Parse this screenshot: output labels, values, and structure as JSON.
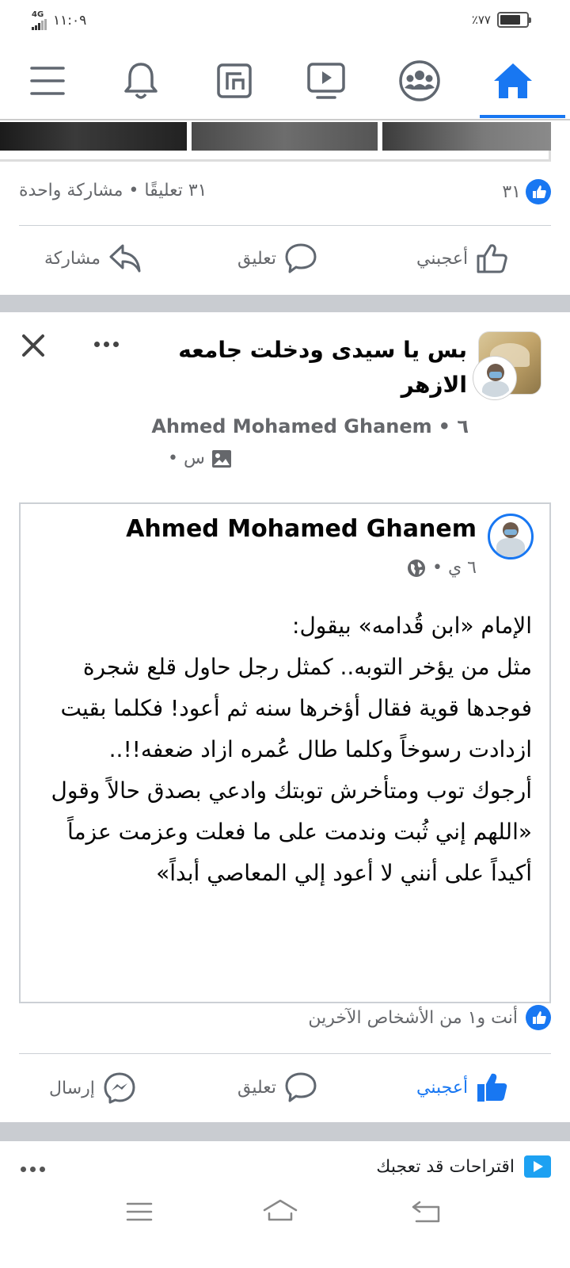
{
  "status_bar": {
    "network": "4G",
    "time": "١١:٠٩",
    "battery": "٪٧٧",
    "battery_level": 0.77
  },
  "top_nav": {
    "items": [
      {
        "icon": "home-icon",
        "active": true
      },
      {
        "icon": "groups-icon",
        "active": false
      },
      {
        "icon": "watch-icon",
        "active": false
      },
      {
        "icon": "pages-icon",
        "active": false
      },
      {
        "icon": "bell-icon",
        "active": false
      },
      {
        "icon": "menu-icon",
        "active": false
      }
    ],
    "accent": "#1877f2"
  },
  "prev_post": {
    "reactions_count": "٣١",
    "comments_shares": "٣١ تعليقًا • مشاركة واحدة",
    "like_label": "أعجبني",
    "comment_label": "تعليق",
    "share_label": "مشاركة"
  },
  "post": {
    "title": "بس يا سيدى ودخلت جامعه الازهر",
    "author": "Ahmed Mohamed Ghanem",
    "time_prefix": "٦ •",
    "time_suffix": "س •",
    "shared": {
      "author": "Ahmed Mohamed Ghanem",
      "time": "٦ ي •",
      "body": "الإمام «ابن قُدامه» بيقول:\nمثل من يؤخر التوبه.. كمثل رجل حاول قلع شجرة فوجدها قوية فقال أؤخرها سنه ثم أعود!  فكلما بقيت ازدادت رسوخاً وكلما طال عُمره ازاد ضعفه!!..\nأرجوك توب ومتأخرش توبتك وادعي بصدق حالاً وقول\n«اللهم إني ثُبت وندمت على ما فعلت وعزمت عزماً أكيداً على أنني لا أعود إلي المعاصي أبداً»"
    },
    "reactions_text": "أنت و١ من الأشخاص الآخرين",
    "like_label": "أعجبني",
    "comment_label": "تعليق",
    "send_label": "إرسال"
  },
  "suggestions": {
    "label": "اقتراحات قد تعجبك"
  }
}
